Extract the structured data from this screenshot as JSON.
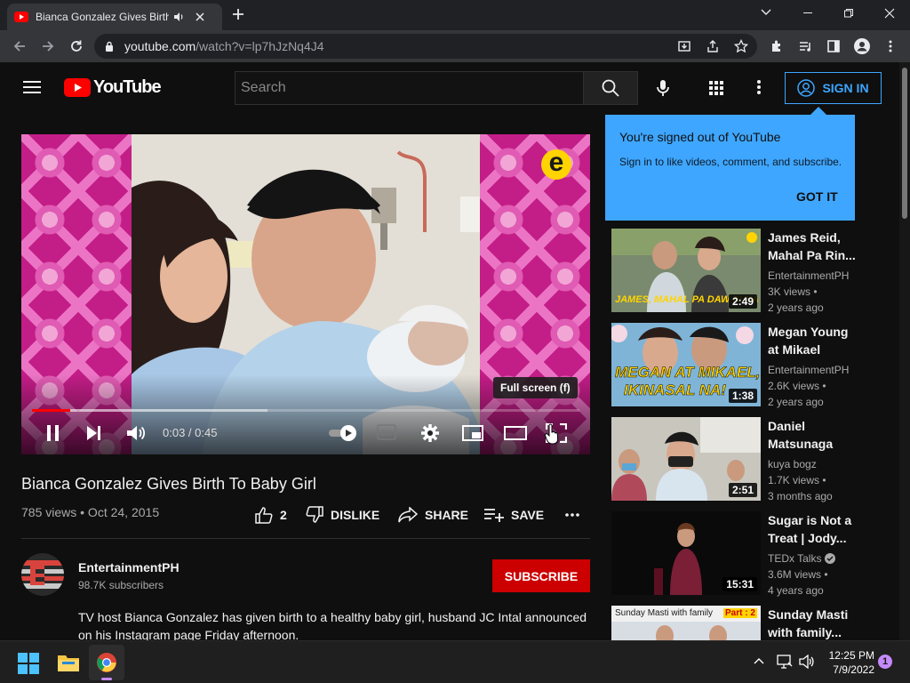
{
  "browser": {
    "tab_title": "Bianca Gonzalez Gives Birth To Baby Girl",
    "url_host": "youtube.com",
    "url_path": "/watch?v=lp7hJzNq4J4"
  },
  "header": {
    "logo": "YouTube",
    "search_placeholder": "Search",
    "sign_in": "SIGN IN"
  },
  "player": {
    "current_time": "0:03",
    "duration": "0:45",
    "time_sep": " / ",
    "tooltip": "Full screen (f)",
    "watermark": "e",
    "progress_fraction": 0.07,
    "buffer_fraction": 0.43
  },
  "video": {
    "title": "Bianca Gonzalez Gives Birth To Baby Girl",
    "views_date": "785 views • Oct 24, 2015",
    "likes": "2",
    "dislike": "DISLIKE",
    "share": "SHARE",
    "save": "SAVE",
    "more": "...",
    "channel": "EntertainmentPH",
    "subscribers": "98.7K subscribers",
    "subscribe": "SUBSCRIBE",
    "description": "TV host Bianca Gonzalez has given birth to a healthy baby girl, husband JC Intal announced on his Instagram page Friday afternoon."
  },
  "popup": {
    "title": "You're signed out of YouTube",
    "body": "Sign in to like videos, comment, and subscribe.",
    "button": "GOT IT"
  },
  "related": [
    {
      "title": "James Reid, Mahal Pa Rin...",
      "channel": "EntertainmentPH",
      "views": "3K views •",
      "age": "2 years ago",
      "duration": "2:49",
      "caption": "JAMES, MAHAL PA DAW SI NA"
    },
    {
      "title": "Megan Young at Mikael Dae...",
      "channel": "EntertainmentPH",
      "views": "2.6K views •",
      "age": "2 years ago",
      "duration": "1:38",
      "caption1": "MEGAN AT MIKAEL,",
      "caption2": "IKINASAL NA!"
    },
    {
      "title": "Daniel Matsunaga @...",
      "channel": "kuya bogz",
      "views": "1.7K views •",
      "age": "3 months ago",
      "duration": "2:51"
    },
    {
      "title": "Sugar is Not a Treat | Jody...",
      "channel": "TEDx Talks",
      "views": "3.6M views •",
      "age": "4 years ago",
      "duration": "15:31"
    },
    {
      "title": "Sunday Masti with family...",
      "caption": "Sunday Masti with family",
      "part": "Part : 2"
    }
  ],
  "taskbar": {
    "time": "12:25 PM",
    "date": "7/9/2022",
    "notifications": "1"
  },
  "colors": {
    "accent_blue": "#3ea6ff",
    "youtube_red": "#ff0000",
    "subscribe_red": "#cc0000",
    "background": "#0f0f0f"
  }
}
